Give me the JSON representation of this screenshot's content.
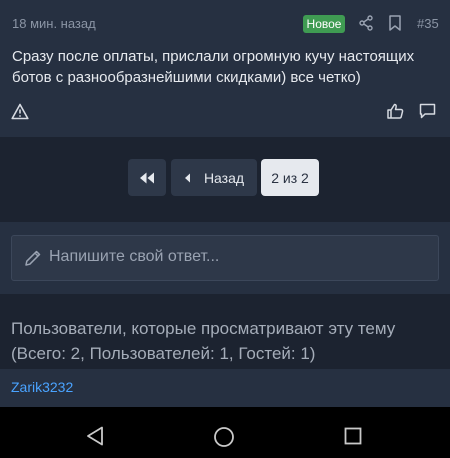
{
  "post": {
    "time": "18 мин. назад",
    "badge_new": "Новое",
    "number": "#35",
    "text": "Сразу после оплаты, прислали огромную кучу настоящих ботов с разнообразнейшими скидками) все четко)",
    "icons": [
      "share-icon",
      "bookmark-icon",
      "warning-icon",
      "like-icon",
      "comment-icon"
    ]
  },
  "pagination": {
    "first_icon": "double-left-icon",
    "prev_label": "Назад",
    "current": "2 из 2"
  },
  "reply": {
    "placeholder": "Напишите свой ответ..."
  },
  "viewers": {
    "title": "Пользователи, которые просматривают эту тему (Всего: 2, Пользователей: 1, Гостей: 1)",
    "users": [
      "Zarik3232"
    ]
  },
  "colors": {
    "background": "#1c2330",
    "panel": "#263041",
    "badge": "#3f9b52",
    "link": "#4aa3ff"
  }
}
